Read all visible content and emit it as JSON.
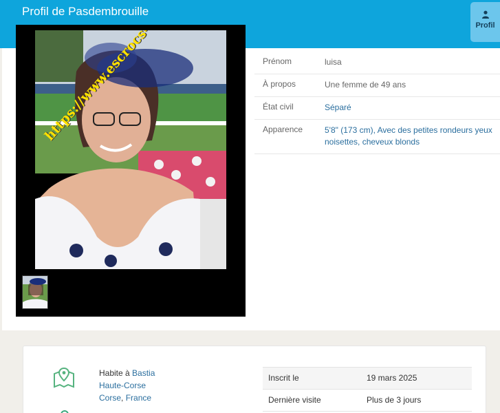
{
  "header": {
    "title": "Profil de Pasdembrouille"
  },
  "tab": {
    "label": "Profil",
    "icon": "user-icon"
  },
  "photo": {
    "watermark": "https://www.escrocs-du-web.fr"
  },
  "details": [
    {
      "label": "Prénom",
      "value": "luisa"
    },
    {
      "label": "À propos",
      "value": "Une femme de 49 ans"
    },
    {
      "label": "État civil",
      "value": "Séparé"
    },
    {
      "label": "Apparence",
      "value": "5'8\" (173 cm), Avec des petites rondeurs yeux noisettes, cheveux blonds"
    }
  ],
  "location": {
    "prefix": "Habite à",
    "city": "Bastia",
    "region": "Haute-Corse",
    "area": "Corse",
    "separator": ",",
    "country": "France"
  },
  "stats": [
    {
      "label": "Inscrit le",
      "value": "19 mars 2025"
    },
    {
      "label": "Dernière visite",
      "value": "Plus de 3 jours"
    }
  ],
  "colors": {
    "header": "#0ea5dc",
    "tab": "#6cc6ec",
    "link": "#2a6e9e",
    "watermark": "#ffe100"
  }
}
